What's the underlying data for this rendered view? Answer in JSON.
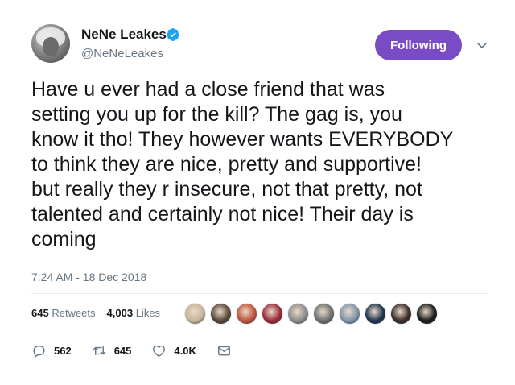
{
  "author": {
    "name": "NeNe Leakes",
    "handle": "@NeNeLeakes",
    "verified_icon": "verified-badge-icon"
  },
  "follow_button": {
    "label": "Following",
    "color": "#794bc4"
  },
  "tweet": {
    "text": "Have u ever had a close friend that was\nsetting you up for the kill? The gag is, you\nknow it tho! They however wants EVERYBODY\nto think they are nice, pretty and supportive!\nbut really they r insecure, not that pretty, not\ntalented and certainly not nice! Their day is\ncoming",
    "timestamp": "7:24 AM - 18 Dec 2018"
  },
  "stats": {
    "retweets_count": "645",
    "retweets_label": "Retweets",
    "likes_count": "4,003",
    "likes_label": "Likes"
  },
  "likers": [
    {
      "color": "#c8b49a"
    },
    {
      "color": "#5a4636"
    },
    {
      "color": "#c0543c"
    },
    {
      "color": "#9c2b3a"
    },
    {
      "color": "#8d8d8d"
    },
    {
      "color": "#6f6f6f"
    },
    {
      "color": "#7e95a8"
    },
    {
      "color": "#1f3550"
    },
    {
      "color": "#3a2c26"
    },
    {
      "color": "#1a1a1a"
    }
  ],
  "actions": {
    "reply_count": "562",
    "retweet_count": "645",
    "like_count": "4.0K"
  },
  "colors": {
    "text": "#14171a",
    "muted": "#657786",
    "twitter_blue": "#1da1f2",
    "divider": "#e6ecf0"
  }
}
